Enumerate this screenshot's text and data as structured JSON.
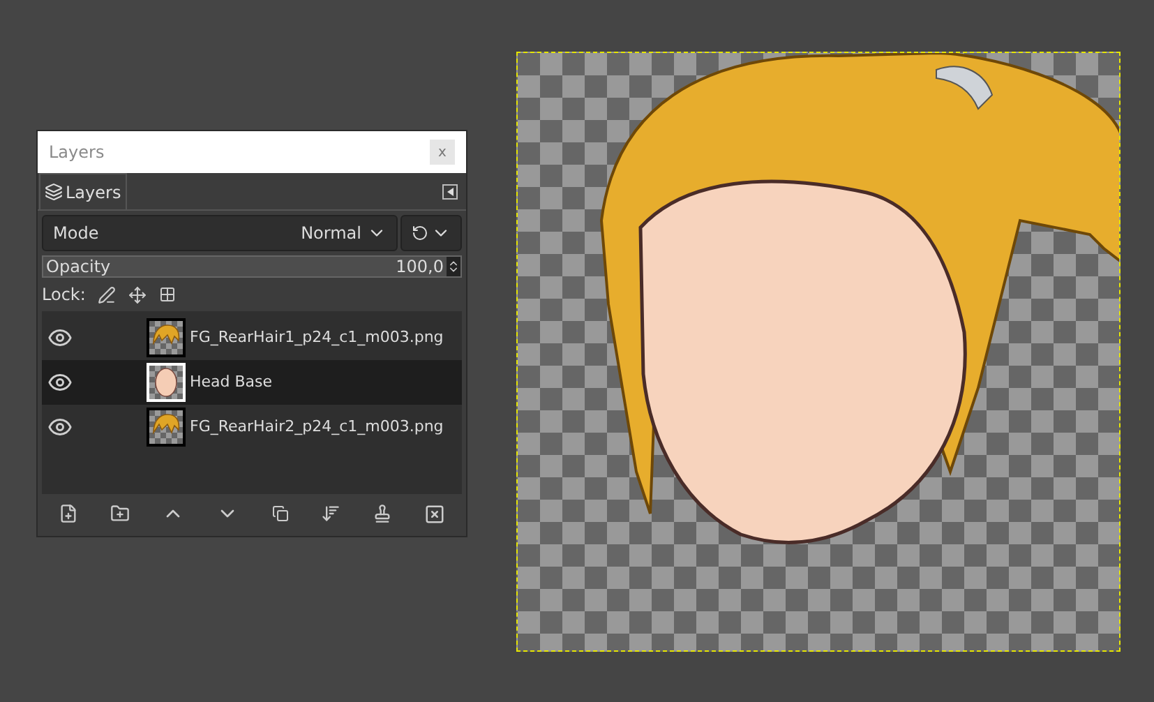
{
  "window": {
    "title": "Layers",
    "close": "x"
  },
  "tab": {
    "label": "Layers"
  },
  "mode": {
    "label": "Mode",
    "value": "Normal"
  },
  "opacity": {
    "label": "Opacity",
    "value": "100,0",
    "level": 1
  },
  "lock": {
    "label": "Lock:"
  },
  "layers": [
    {
      "name": "FG_RearHair1_p24_c1_m003.png",
      "visible": true,
      "selected": false,
      "kind": "hair"
    },
    {
      "name": "Head Base",
      "visible": true,
      "selected": true,
      "kind": "head"
    },
    {
      "name": "FG_RearHair2_p24_c1_m003.png",
      "visible": true,
      "selected": false,
      "kind": "hair"
    }
  ]
}
